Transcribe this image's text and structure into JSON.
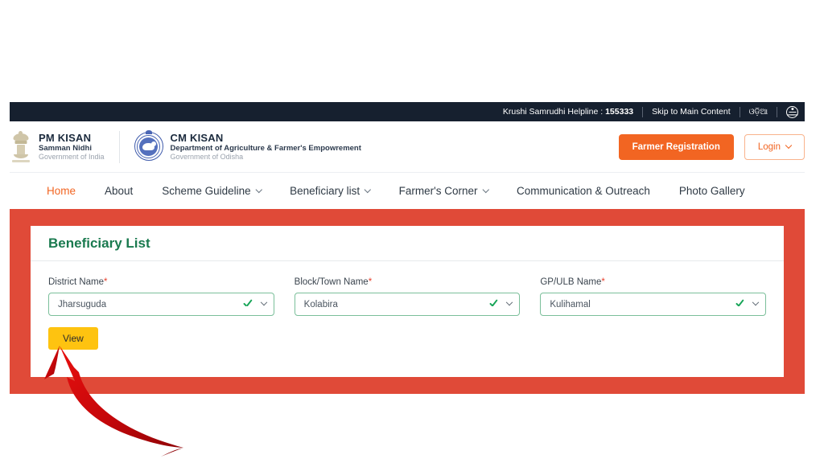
{
  "topbar": {
    "helpline_label": "Krushi Samrudhi Helpline : ",
    "helpline_number": "155333",
    "skip_link": "Skip to Main Content",
    "language_toggle": "ଓଡ଼ିଆ",
    "accessibility_icon": "accessibility-icon"
  },
  "header": {
    "pm_kisan": {
      "emblem_icon": "india-national-emblem-icon",
      "title": "PM KISAN",
      "sub1": "Samman Nidhi",
      "sub2": "Government of India"
    },
    "cm_kisan": {
      "emblem_icon": "odisha-government-seal-icon",
      "title": "CM KISAN",
      "sub1": "Department of Agriculture & Farmer's Empowrement",
      "sub2": "Government of Odisha"
    },
    "register_button": "Farmer Registration",
    "login_button": "Login",
    "login_caret_icon": "chevron-down-icon"
  },
  "nav": {
    "items": [
      {
        "label": "Home",
        "has_caret": false,
        "active": true
      },
      {
        "label": "About",
        "has_caret": false,
        "active": false
      },
      {
        "label": "Scheme Guideline",
        "has_caret": true,
        "active": false
      },
      {
        "label": "Beneficiary list",
        "has_caret": true,
        "active": false
      },
      {
        "label": "Farmer's Corner",
        "has_caret": true,
        "active": false
      },
      {
        "label": "Communication & Outreach",
        "has_caret": false,
        "active": false
      },
      {
        "label": "Photo Gallery",
        "has_caret": false,
        "active": false
      }
    ]
  },
  "card": {
    "title": "Beneficiary List",
    "fields": [
      {
        "label": "District Name",
        "required_mark": "*",
        "value": "Jharsuguda",
        "valid_icon": "checkmark-icon",
        "caret_icon": "chevron-down-icon"
      },
      {
        "label": "Block/Town Name",
        "required_mark": "*",
        "value": "Kolabira",
        "valid_icon": "checkmark-icon",
        "caret_icon": "chevron-down-icon"
      },
      {
        "label": "GP/ULB Name",
        "required_mark": "*",
        "value": "Kulihamal",
        "valid_icon": "checkmark-icon",
        "caret_icon": "chevron-down-icon"
      }
    ],
    "view_button": "View"
  },
  "annotation": {
    "arrow_icon": "curved-arrow-pointing-to-view-button",
    "arrow_color": "#c00000"
  },
  "colors": {
    "topbar_bg": "#16202f",
    "brand_orange": "#f26522",
    "highlight_red": "#e04a38",
    "title_green": "#1a7a4f",
    "button_yellow": "#fec310",
    "field_border_green": "#7bbf9a",
    "check_green": "#18a558",
    "required_red": "#e8422e"
  }
}
